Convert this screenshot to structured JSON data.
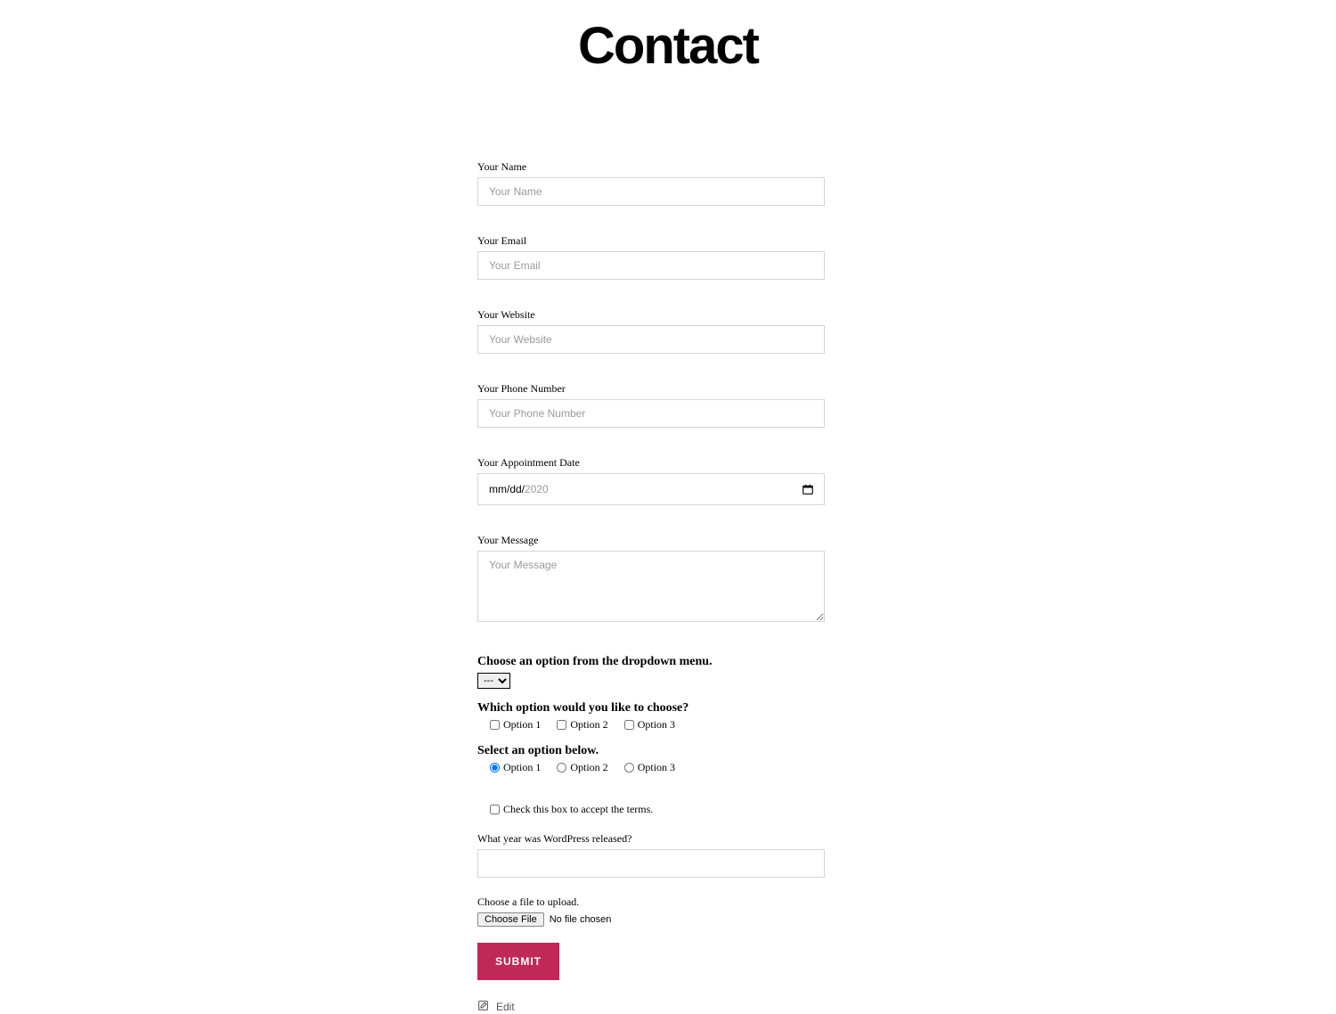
{
  "page": {
    "title": "Contact"
  },
  "fields": {
    "name": {
      "label": "Your Name",
      "placeholder": "Your Name"
    },
    "email": {
      "label": "Your Email",
      "placeholder": "Your Email"
    },
    "website": {
      "label": "Your Website",
      "placeholder": "Your Website"
    },
    "phone": {
      "label": "Your Phone Number",
      "placeholder": "Your Phone Number"
    },
    "date": {
      "label": "Your Appointment Date",
      "display_prefix": "mm/dd/",
      "display_year": "2020"
    },
    "message": {
      "label": "Your Message",
      "placeholder": "Your Message"
    }
  },
  "dropdown": {
    "heading": "Choose an option from the dropdown menu.",
    "selected": "---"
  },
  "checkbox_group": {
    "heading": "Which option would you like to choose?",
    "options": [
      "Option 1",
      "Option 2",
      "Option 3"
    ]
  },
  "radio_group": {
    "heading": "Select an option below.",
    "options": [
      "Option 1",
      "Option 2",
      "Option 3"
    ],
    "selected_index": 0
  },
  "terms": {
    "label": "Check this box to accept the terms."
  },
  "quiz": {
    "label": "What year was WordPress released?"
  },
  "file": {
    "label": "Choose a file to upload.",
    "button": "Choose File",
    "status": "No file chosen"
  },
  "submit": {
    "label": "SUBMIT"
  },
  "edit": {
    "label": "Edit"
  }
}
